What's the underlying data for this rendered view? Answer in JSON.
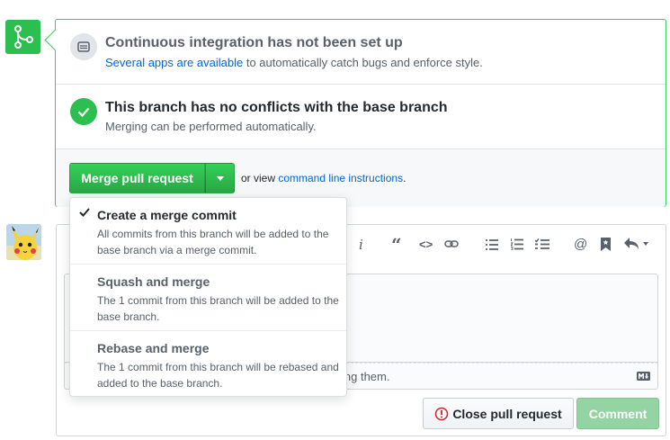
{
  "ci": {
    "title": "Continuous integration has not been set up",
    "link_text": "Several apps are available",
    "desc_rest": " to automatically catch bugs and enforce style."
  },
  "conflicts": {
    "title": "This branch has no conflicts with the base branch",
    "desc": "Merging can be performed automatically."
  },
  "merge": {
    "button_label": "Merge pull request",
    "cli_prefix": "or view ",
    "cli_link": "command line instructions",
    "cli_suffix": "."
  },
  "dropdown": {
    "options": [
      {
        "title": "Create a merge commit",
        "desc": "All commits from this branch will be added to the base branch via a merge commit.",
        "selected": true
      },
      {
        "title": "Squash and merge",
        "desc": "The 1 commit from this branch will be added to the base branch.",
        "selected": false
      },
      {
        "title": "Rebase and merge",
        "desc": "The 1 commit from this branch will be rebased and added to the base branch.",
        "selected": false
      }
    ]
  },
  "comment": {
    "footer_text": "ing them.",
    "close_label": "Close pull request",
    "comment_label": "Comment"
  },
  "toolbar": {
    "italic": "i",
    "quote": "“",
    "code": "<>",
    "mention": "@"
  },
  "colors": {
    "success": "#2cbe4e",
    "link": "#0366d6",
    "border_green": "#34d058"
  }
}
